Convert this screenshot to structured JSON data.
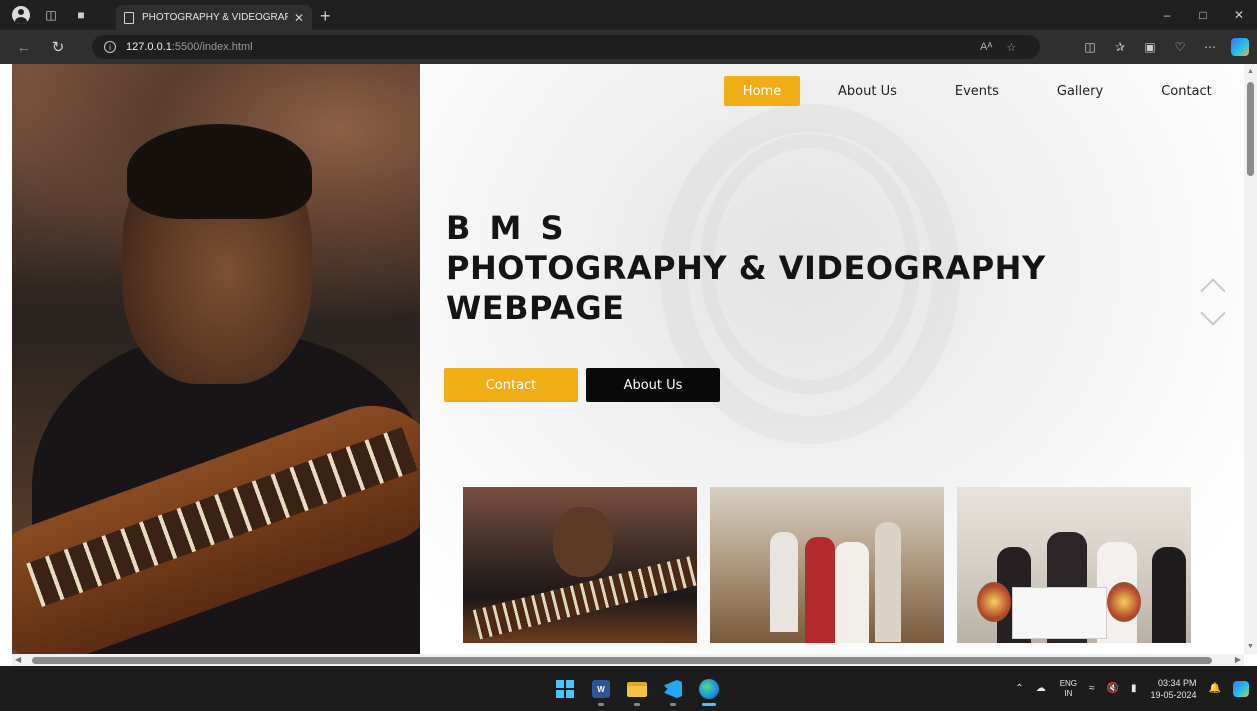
{
  "browser": {
    "tab_title": "PHOTOGRAPHY & VIDEOGRAPH",
    "address_host": "127.0.0.1",
    "address_path": ":5500/index.html",
    "reader_label": "Aᴬ"
  },
  "nav": {
    "items": [
      {
        "label": "Home",
        "active": true
      },
      {
        "label": "About Us",
        "active": false
      },
      {
        "label": "Events",
        "active": false
      },
      {
        "label": "Gallery",
        "active": false
      },
      {
        "label": "Contact",
        "active": false
      }
    ]
  },
  "hero": {
    "title_line1": "B M S",
    "title_line2": "PHOTOGRAPHY & VIDEOGRAPHY",
    "title_line3": "WEBPAGE",
    "contact_button": "Contact",
    "about_button": "About Us"
  },
  "taskbar": {
    "language": "ENG",
    "region": "IN",
    "time": "03:34 PM",
    "date": "19-05-2024"
  },
  "colors": {
    "accent": "#f0ad16",
    "dark_button": "#0a0a0a"
  }
}
